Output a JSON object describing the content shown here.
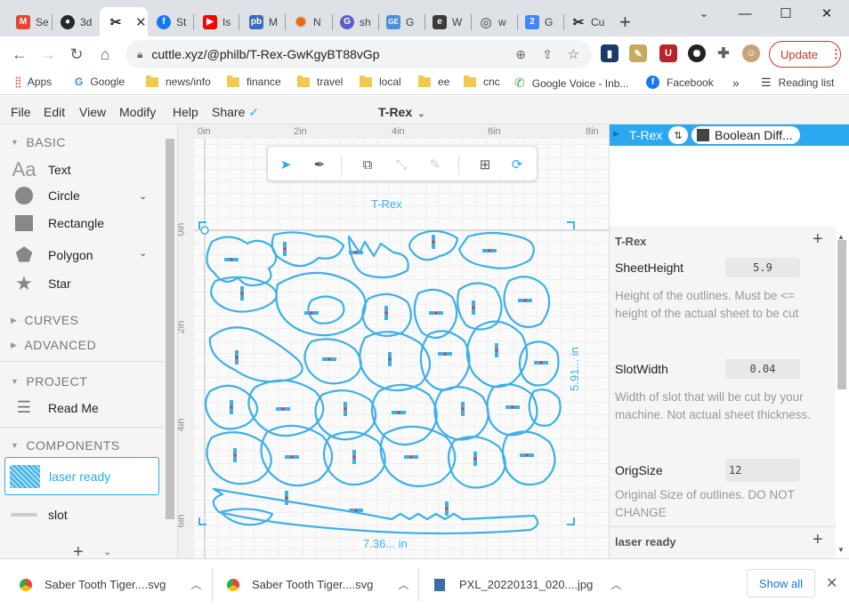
{
  "tabs": [
    {
      "label": "Se",
      "icon": "gmail-icon",
      "color": "#ea4335",
      "glyph": "M"
    },
    {
      "label": "3d",
      "icon": "github-icon",
      "color": "#24292e",
      "glyph": "●"
    },
    {
      "label": "",
      "icon": "cuttle-icon",
      "color": "#222",
      "glyph": "✂",
      "active": true
    },
    {
      "label": "St",
      "icon": "facebook-icon",
      "color": "#1877f2",
      "glyph": "f"
    },
    {
      "label": "Is",
      "icon": "youtube-icon",
      "color": "#ff0000",
      "glyph": "▶"
    },
    {
      "label": "M",
      "icon": "pb-icon",
      "color": "#3b6ab8",
      "glyph": "pb"
    },
    {
      "label": "N",
      "icon": "gear-orange-icon",
      "color": "#e86a17",
      "glyph": "✺"
    },
    {
      "label": "sh",
      "icon": "google-circle-icon",
      "color": "#5b5fc7",
      "glyph": "G"
    },
    {
      "label": "G",
      "icon": "gsheets-icon",
      "color": "#4a90d9",
      "glyph": "GE"
    },
    {
      "label": "W",
      "icon": "ebay-icon",
      "color": "#3a3a3a",
      "glyph": "e"
    },
    {
      "label": "w",
      "icon": "globe-icon",
      "color": "#777",
      "glyph": "◎"
    },
    {
      "label": "G",
      "icon": "calendar-icon",
      "color": "#4285f4",
      "glyph": "2"
    },
    {
      "label": "Cu",
      "icon": "cuttle-icon",
      "color": "#222",
      "glyph": "✂"
    }
  ],
  "address": {
    "url": "cuttle.xyz/@philb/T-Rex-GwKgyBT88vGp"
  },
  "update_label": "Update",
  "bookmarks": [
    {
      "label": "Apps",
      "type": "apps"
    },
    {
      "label": "Google",
      "type": "google"
    },
    {
      "label": "news/info",
      "type": "folder"
    },
    {
      "label": "finance",
      "type": "folder"
    },
    {
      "label": "travel",
      "type": "folder"
    },
    {
      "label": "local",
      "type": "folder"
    },
    {
      "label": "ee",
      "type": "folder"
    },
    {
      "label": "cnc",
      "type": "folder"
    },
    {
      "label": "Google Voice - Inb...",
      "type": "voice"
    },
    {
      "label": "Facebook",
      "type": "facebook"
    }
  ],
  "reading_list": "Reading list",
  "app_menu": {
    "file": "File",
    "edit": "Edit",
    "view": "View",
    "modify": "Modify",
    "help": "Help",
    "share": "Share",
    "doc_title": "T-Rex"
  },
  "left": {
    "basic": "BASIC",
    "items": {
      "text": "Text",
      "text_icon": "Aa",
      "circle": "Circle",
      "rectangle": "Rectangle",
      "polygon": "Polygon",
      "star": "Star"
    },
    "curves": "CURVES",
    "advanced": "ADVANCED",
    "project": "PROJECT",
    "read_me": "Read Me",
    "components": "COMPONENTS",
    "laser_ready": "laser ready",
    "slot": "slot"
  },
  "canvas": {
    "ruler_x": [
      "0in",
      "2in",
      "4in",
      "6in",
      "8in"
    ],
    "ruler_y": [
      "0in",
      "2in",
      "4in",
      "6in"
    ],
    "label": "T-Rex",
    "width_dim": "7.36... in",
    "height_dim": "5.91... in"
  },
  "right": {
    "header_item": "T-Rex",
    "boolean": "Boolean Diff...",
    "section": "T-Rex",
    "params": [
      {
        "name": "SheetHeight",
        "value": "5.9",
        "desc": "Height of the outlines. Must be <= height of the actual sheet to be cut"
      },
      {
        "name": "SlotWidth",
        "value": "0.04",
        "desc": "Width of slot that will be cut by your machine. Not actual sheet thickness."
      },
      {
        "name": "OrigSize",
        "value": "12",
        "desc": "Original Size of outlines.  DO NOT CHANGE"
      }
    ],
    "laser_ready": "laser ready"
  },
  "downloads": [
    {
      "label": "Saber Tooth Tiger....svg",
      "icon": "chrome-icon"
    },
    {
      "label": "Saber Tooth Tiger....svg",
      "icon": "chrome-icon"
    },
    {
      "label": "PXL_20220131_020....jpg",
      "icon": "image-file-icon"
    }
  ],
  "show_all": "Show all",
  "colors": {
    "accent": "#2ba8f0",
    "shape": "#3db0e8"
  }
}
